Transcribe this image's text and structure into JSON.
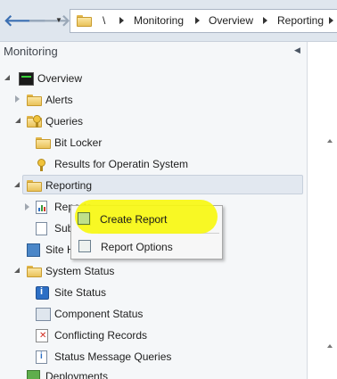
{
  "breadcrumb": {
    "root": "\\",
    "items": [
      "Monitoring",
      "Overview",
      "Reporting"
    ]
  },
  "nav": {
    "title": "Monitoring",
    "tree": {
      "overview": "Overview",
      "alerts": "Alerts",
      "queries": "Queries",
      "bitlocker": "Bit Locker",
      "results": "Results for Operatin System",
      "reporting": "Reporting",
      "reports": "Reports",
      "subscriptions": "Subscriptions",
      "site_hierarchy": "Site Hierarchy",
      "system_status": "System Status",
      "site_status": "Site Status",
      "component_status": "Component Status",
      "conflicting_records": "Conflicting Records",
      "status_message_queries": "Status Message Queries",
      "deployments": "Deployments"
    }
  },
  "context_menu": {
    "items": [
      "Create Report",
      "Report Options"
    ]
  },
  "colors": {
    "highlight": "#f7f711",
    "selection": "#e2e8f0",
    "folder": "#f0c95c"
  }
}
